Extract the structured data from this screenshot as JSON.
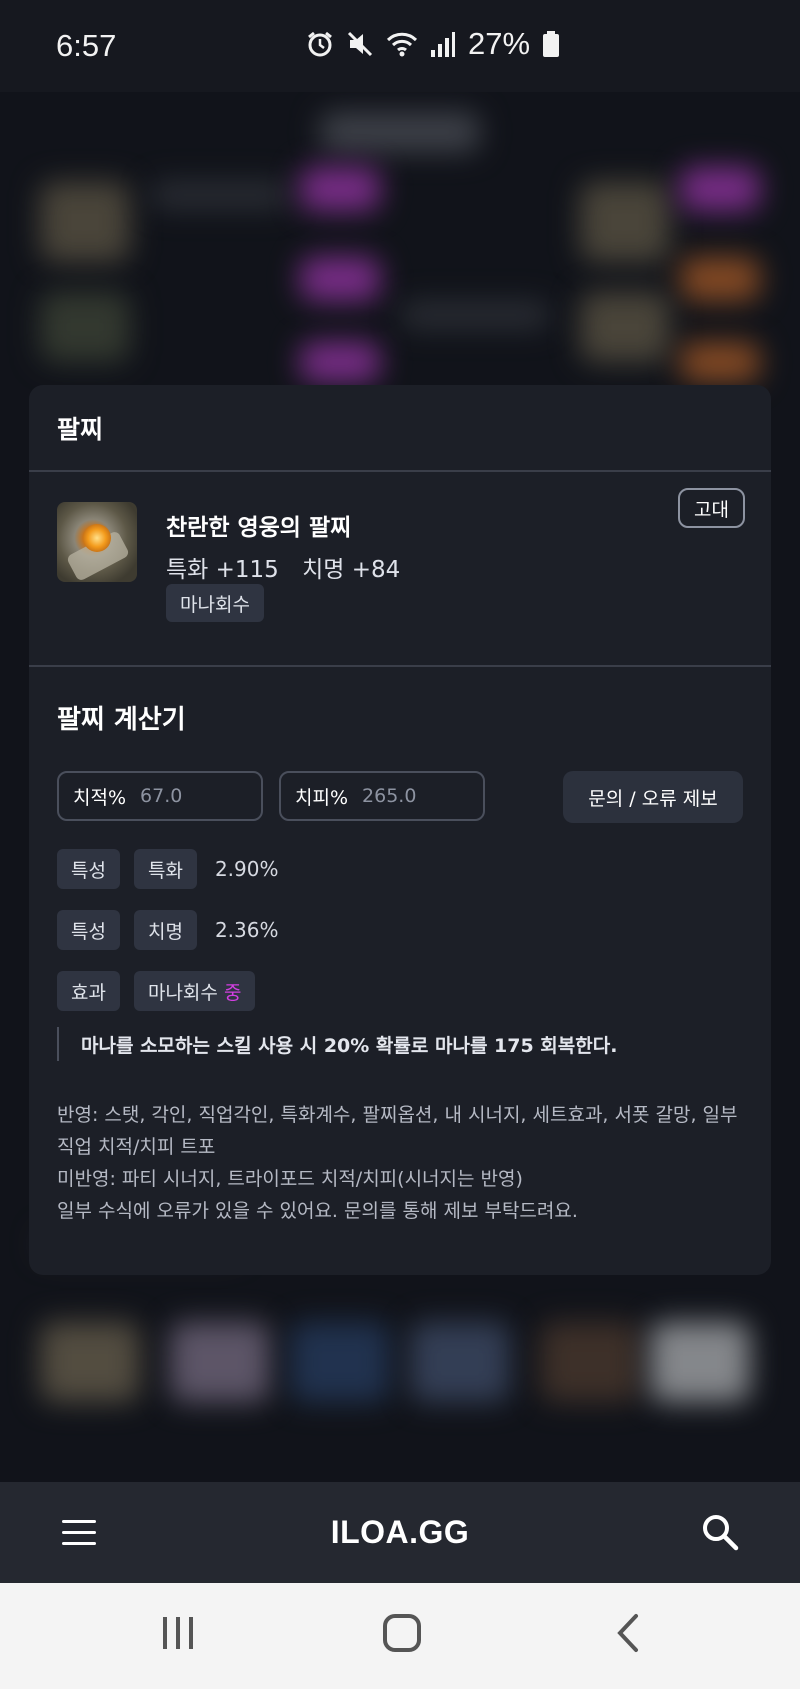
{
  "status_bar": {
    "time": "6:57",
    "battery": "27%",
    "icons": [
      "alarm-icon",
      "mute-icon",
      "wifi-icon",
      "signal-icon",
      "battery-icon"
    ]
  },
  "modal": {
    "title": "팔찌",
    "item": {
      "name": "찬란한 영웅의 팔찌",
      "stat1": "특화 +115",
      "stat2": "치명 +84",
      "grade": "고대",
      "effect_tag": "마나회수",
      "icon": "bracelet-item-icon"
    },
    "calculator": {
      "title": "팔찌 계산기",
      "crit_rate_label": "치적%",
      "crit_rate_value": "67.0",
      "crit_dmg_label": "치피%",
      "crit_dmg_value": "265.0",
      "report_button": "문의 / 오류 제보",
      "rows": [
        {
          "type": "특성",
          "stat": "특화",
          "value": "2.90%"
        },
        {
          "type": "특성",
          "stat": "치명",
          "value": "2.36%"
        }
      ],
      "effect": {
        "type": "효과",
        "name": "마나회수",
        "level": "중",
        "description": "마나를 소모하는 스킬 사용 시 20% 확률로 마나를 175 회복한다."
      },
      "notes": {
        "line1": "반영: 스탯, 각인, 직업각인, 특화계수, 팔찌옵션, 내 시너지, 세트효과, 서폿 갈망, 일부 직업 치적/치피 트포",
        "line2": "미반영: 파티 시너지, 트라이포드 치적/치피(시너지는 반영)",
        "line3": "일부 수식에 오류가 있을 수 있어요. 문의를 통해 제보 부탁드려요."
      }
    }
  },
  "app_bar": {
    "logo": "ILOA.GG",
    "menu_icon": "hamburger-menu-icon",
    "search_icon": "search-icon"
  },
  "colors": {
    "background": "#16181f",
    "card": "#1c1f27",
    "tag": "#2f3441",
    "accent_mid": "#d23fe0"
  }
}
